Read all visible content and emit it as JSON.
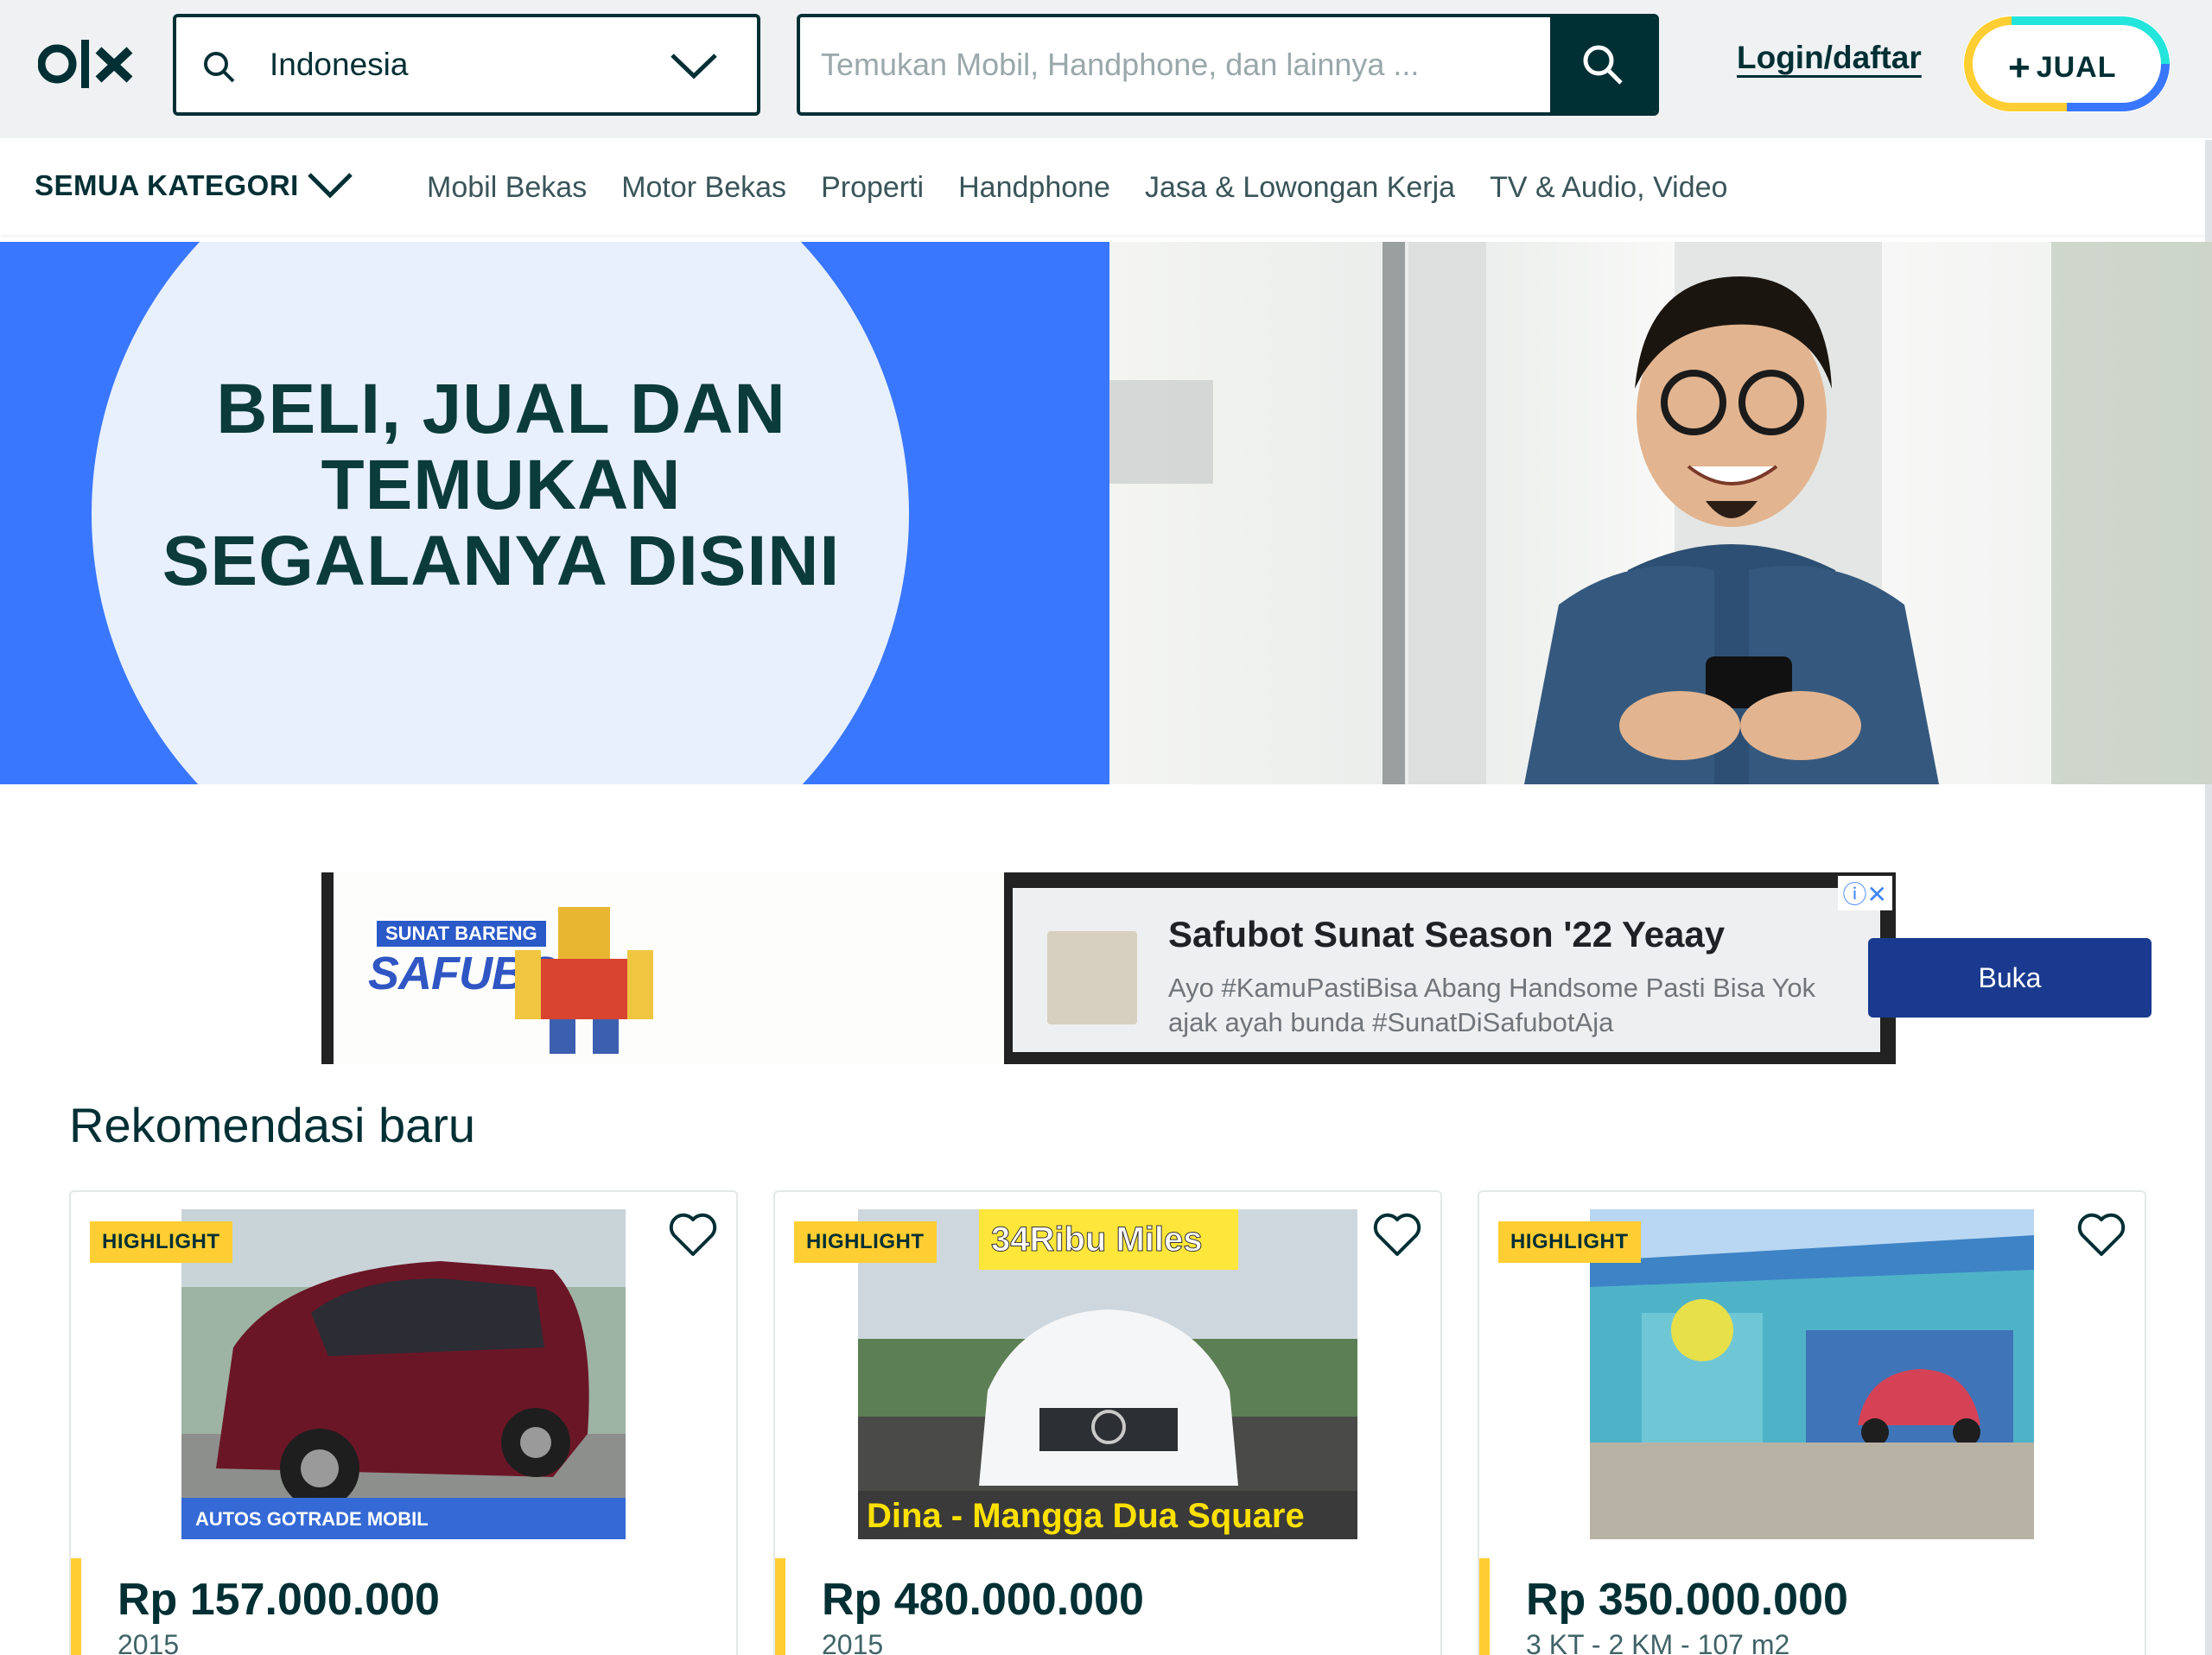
{
  "header": {
    "location_value": "Indonesia",
    "search_placeholder": "Temukan Mobil, Handphone, dan lainnya ...",
    "login_label": "Login/daftar",
    "sell_label": "JUAL"
  },
  "categories": {
    "all_label": "SEMUA KATEGORI",
    "items": [
      "Mobil Bekas",
      "Motor Bekas",
      "Properti",
      "Handphone",
      "Jasa & Lowongan Kerja",
      "TV & Audio, Video"
    ]
  },
  "hero": {
    "line1": "BELI, JUAL DAN",
    "line2": "TEMUKAN",
    "line3": "SEGALANYA DISINI"
  },
  "ad": {
    "title": "Safubot Sunat Season '22 Yeaay",
    "description": "Ayo #KamuPastiBisa Abang Handsome Pasti Bisa Yok ajak ayah bunda #SunatDiSafubotAja",
    "cta": "Buka",
    "brand_text": "SAFUBOT",
    "brand_sub": "SUNAT BARENG"
  },
  "recommendations": {
    "title": "Rekomendasi baru",
    "listings": [
      {
        "badge": "HIGHLIGHT",
        "price": "Rp 157.000.000",
        "detail": "2015",
        "overlay_bottom": "AUTOS  GOTRADE MOBIL",
        "overlay_top": ""
      },
      {
        "badge": "HIGHLIGHT",
        "price": "Rp 480.000.000",
        "detail": "2015",
        "overlay_bottom": "Dina - Mangga Dua Square",
        "overlay_top": "34Ribu Miles"
      },
      {
        "badge": "HIGHLIGHT",
        "price": "Rp 350.000.000",
        "detail": "3 KT - 2 KM - 107 m2",
        "overlay_bottom": "",
        "overlay_top": ""
      }
    ]
  },
  "colors": {
    "primary": "#002f34",
    "hero_blue": "#3a77ff",
    "highlight_yellow": "#ffce32",
    "ad_button": "#1a3a8f"
  }
}
